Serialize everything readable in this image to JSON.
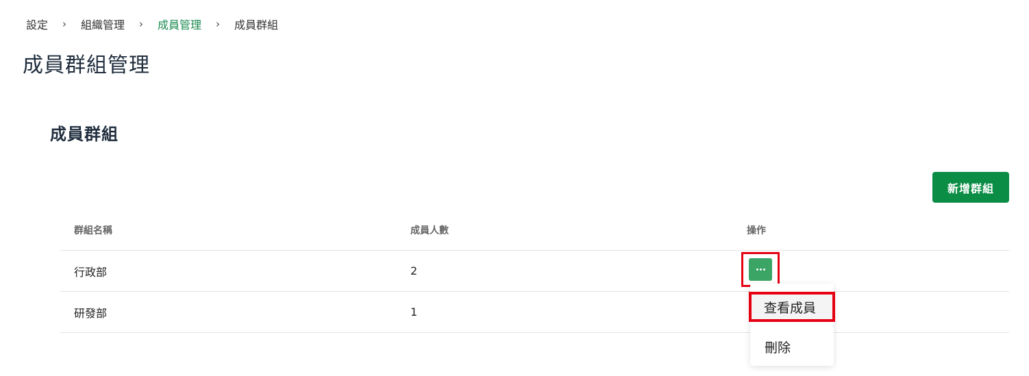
{
  "breadcrumb": {
    "items": [
      "設定",
      "組織管理",
      "成員管理",
      "成員群組"
    ],
    "separator": "›"
  },
  "page": {
    "title": "成員群組管理",
    "section_title": "成員群組",
    "add_button_label": "新增群組"
  },
  "table": {
    "headers": [
      "群組名稱",
      "成員人數",
      "操作"
    ],
    "rows": [
      {
        "name": "行政部",
        "count": "2"
      },
      {
        "name": "研發部",
        "count": "1"
      }
    ]
  },
  "menu": {
    "items": [
      "查看成員",
      "刪除"
    ]
  },
  "colors": {
    "accent": "#0b8d45",
    "ops_button": "#3aa565",
    "highlight": "#e50012",
    "breadcrumb_active": "#1a8a4f"
  },
  "icons": {
    "ops": "more-horizontal-icon",
    "separator": "chevron-right-icon"
  }
}
